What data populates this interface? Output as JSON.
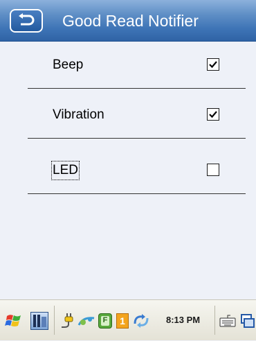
{
  "header": {
    "title": "Good Read Notifier",
    "back_icon": "back-arrow-icon"
  },
  "options": [
    {
      "label": "Beep",
      "checked": true
    },
    {
      "label": "Vibration",
      "checked": true
    },
    {
      "label": "LED",
      "checked": false
    }
  ],
  "taskbar": {
    "time": "8:13 PM",
    "badge_f": "F",
    "badge_1": "1",
    "icons": [
      "windows-start-icon",
      "app-icon",
      "power-plug-icon",
      "network-icon",
      "f-badge-icon",
      "one-badge-icon",
      "sync-icon",
      "keyboard-icon",
      "window-switch-icon"
    ]
  },
  "colors": {
    "title_bar": "#3e74b6",
    "background": "#eef1f8",
    "taskbar": "#e4e2d6"
  }
}
